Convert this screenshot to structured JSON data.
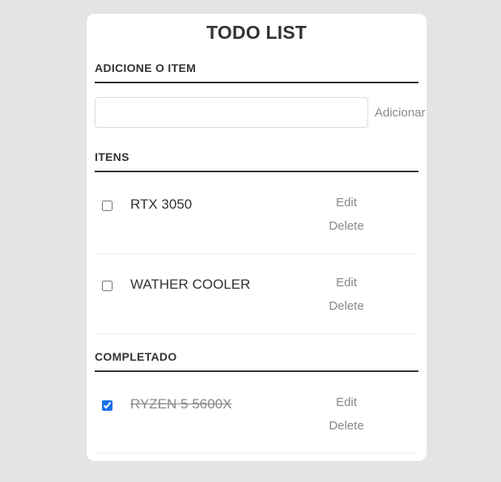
{
  "app": {
    "title": "TODO LIST"
  },
  "add_section": {
    "heading": "ADICIONE O ITEM",
    "input_value": "",
    "input_placeholder": "",
    "button_label": "Adicionar"
  },
  "todo_section": {
    "heading": "ITENS",
    "items": [
      {
        "label": "RTX 3050",
        "checked": false,
        "edit_label": "Edit",
        "delete_label": "Delete"
      },
      {
        "label": "WATHER COOLER",
        "checked": false,
        "edit_label": "Edit",
        "delete_label": "Delete"
      }
    ]
  },
  "completed_section": {
    "heading": "COMPLETADO",
    "items": [
      {
        "label": "RYZEN 5 5600X",
        "checked": true,
        "edit_label": "Edit",
        "delete_label": "Delete"
      }
    ]
  },
  "colors": {
    "background": "#e4e4e4",
    "card": "#ffffff",
    "text": "#333333",
    "muted": "#888888",
    "checkbox_accent": "#1a73e8"
  }
}
